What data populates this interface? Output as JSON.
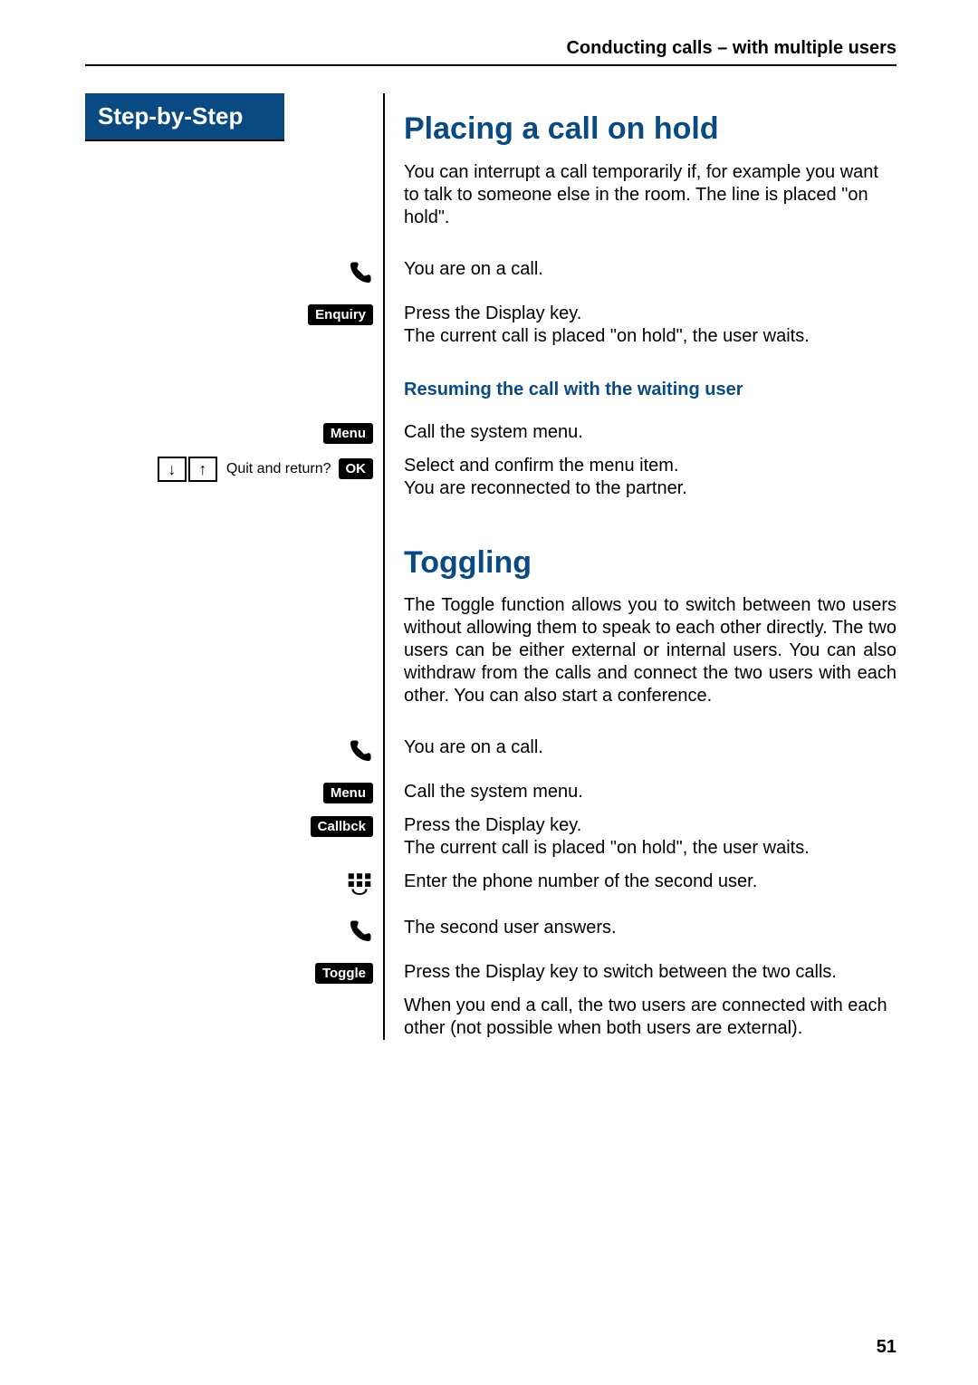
{
  "header": "Conducting calls – with multiple users",
  "step_header": "Step-by-Step",
  "page_number": "51",
  "section1": {
    "title": "Placing a call on hold",
    "intro": "You can interrupt a call temporarily if, for example  you want to talk to someone else in the room. The line is placed \"on hold\".",
    "rows": {
      "on_call": "You are on a call.",
      "enquiry_key": "Enquiry",
      "press_display_1": "Press the Display key.",
      "press_display_2": "The current call is placed \"on hold\", the user waits.",
      "subheading": "Resuming the call with the waiting user",
      "menu_key": "Menu",
      "call_menu": "Call the system menu.",
      "quit_return_label": "Quit and return?",
      "ok_key": "OK",
      "select_confirm_1": "Select and confirm the menu item.",
      "select_confirm_2": "You are reconnected to the partner."
    }
  },
  "section2": {
    "title": "Toggling",
    "intro": "The Toggle function allows you to switch between two users without allowing them to speak to each other directly. The two users can be either external or internal users. You can also withdraw from the calls and connect the two users with each other. You can also start a conference.",
    "rows": {
      "on_call": "You are on a call.",
      "menu_key": "Menu",
      "call_menu": "Call the system menu.",
      "callbck_key": "Callbck",
      "press_display_1": "Press the Display key.",
      "press_display_2": "The current call is placed \"on hold\", the user waits.",
      "enter_number": "Enter the phone number of the second user.",
      "second_answers": "The second user answers.",
      "toggle_key": "Toggle",
      "toggle_text": "Press the Display key to switch between the two calls.",
      "end_call": "When you end a call, the two users are connected with each other (not possible when both users are external)."
    }
  }
}
